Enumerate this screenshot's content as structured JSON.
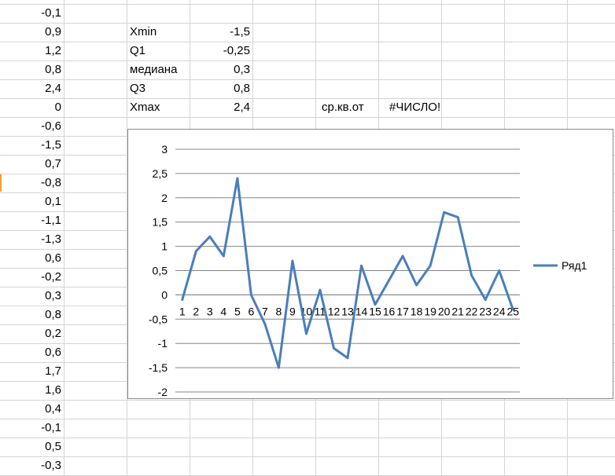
{
  "column_a_values": [
    "-0,1",
    "0,9",
    "1,2",
    "0,8",
    "2,4",
    "0",
    "-0,6",
    "-1,5",
    "0,7",
    "-0,8",
    "0,1",
    "-1,1",
    "-1,3",
    "0,6",
    "-0,2",
    "0,3",
    "0,8",
    "0,2",
    "0,6",
    "1,7",
    "1,6",
    "0,4",
    "-0,1",
    "0,5",
    "-0,3"
  ],
  "stats": [
    {
      "label": "Xmin",
      "value": "-1,5"
    },
    {
      "label": "Q1",
      "value": "-0,25"
    },
    {
      "label": "медиана",
      "value": "0,3"
    },
    {
      "label": "Q3",
      "value": "0,8"
    },
    {
      "label": "Xmax",
      "value": "2,4"
    }
  ],
  "stdev": {
    "label": "ср.кв.от",
    "value": "#ЧИСЛО!"
  },
  "colors": {
    "series": "#4a7ebb",
    "grid": "#d4d4d4",
    "chart_gridline": "#868686",
    "selection": "#f0a030"
  },
  "chart_data": {
    "type": "line",
    "categories": [
      "1",
      "2",
      "3",
      "4",
      "5",
      "6",
      "7",
      "8",
      "9",
      "10",
      "11",
      "12",
      "13",
      "14",
      "15",
      "16",
      "17",
      "18",
      "19",
      "20",
      "21",
      "22",
      "23",
      "24",
      "25"
    ],
    "series": [
      {
        "name": "Ряд1",
        "values": [
          -0.1,
          0.9,
          1.2,
          0.8,
          2.4,
          0,
          -0.6,
          -1.5,
          0.7,
          -0.8,
          0.1,
          -1.1,
          -1.3,
          0.6,
          -0.2,
          0.3,
          0.8,
          0.2,
          0.6,
          1.7,
          1.6,
          0.4,
          -0.1,
          0.5,
          -0.3
        ]
      }
    ],
    "y_ticks": [
      "3",
      "2,5",
      "2",
      "1,5",
      "1",
      "0,5",
      "0",
      "-0,5",
      "-1",
      "-1,5",
      "-2"
    ],
    "ylim": [
      -2,
      3
    ],
    "grid": true,
    "legend": "right"
  }
}
